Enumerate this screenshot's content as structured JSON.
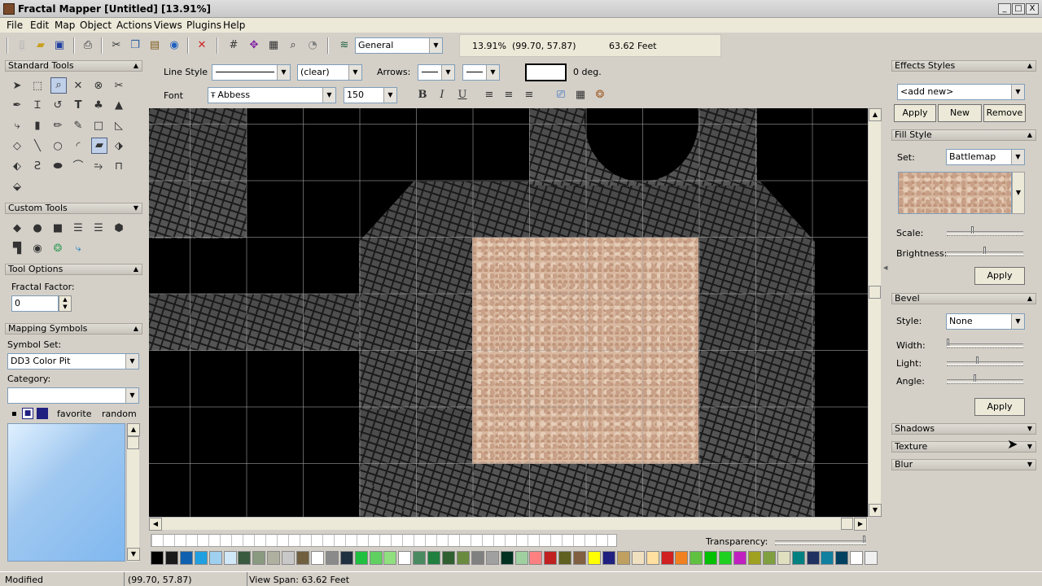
{
  "window": {
    "title": "Fractal Mapper [Untitled] [13.91%]",
    "min": "_",
    "max": "□",
    "close": "X"
  },
  "menu": [
    "File",
    "Edit",
    "Map",
    "Object",
    "Actions",
    "Views",
    "Plugins",
    "Help"
  ],
  "toolbar": {
    "layer": "General",
    "zoom": "13.91%",
    "coords": "(99.70, 57.87)",
    "span": "63.62 Feet"
  },
  "linestyle": {
    "label": "Line Style",
    "fill": "(clear)",
    "arrows_label": "Arrows:",
    "angle": "0 deg."
  },
  "font": {
    "label": "Font",
    "name": "Abbess",
    "size": "150",
    "bold": "B",
    "italic": "I",
    "underline": "U"
  },
  "left": {
    "standard_tools": "Standard Tools",
    "custom_tools": "Custom Tools",
    "tool_options": "Tool Options",
    "fractal_label": "Fractal Factor:",
    "fractal_value": "0",
    "mapping_symbols": "Mapping Symbols",
    "symbol_set_label": "Symbol Set:",
    "symbol_set": "DD3 Color Pit",
    "category_label": "Category:",
    "category": "",
    "favorite": "favorite",
    "random": "random"
  },
  "right": {
    "effects_title": "Effects Styles",
    "effects_combo": "<add new>",
    "apply": "Apply",
    "new": "New",
    "remove": "Remove",
    "fill_title": "Fill Style",
    "set_label": "Set:",
    "set_value": "Battlemap",
    "scale_label": "Scale:",
    "brightness_label": "Brightness:",
    "fill_apply": "Apply",
    "bevel_title": "Bevel",
    "style_label": "Style:",
    "style_value": "None",
    "width_label": "Width:",
    "light_label": "Light:",
    "angle_label": "Angle:",
    "bevel_apply": "Apply",
    "shadows": "Shadows",
    "texture": "Texture",
    "blur": "Blur"
  },
  "palette": {
    "transparency_label": "Transparency:",
    "colors": [
      "#000000",
      "#1a1a1a",
      "#1060b0",
      "#20a0e0",
      "#a0d0f0",
      "#d0e8f8",
      "#3a5a40",
      "#8a9a80",
      "#b0b0a0",
      "#c8c8c8",
      "#706040",
      "#ffffff",
      "#8a8a8a",
      "#203040",
      "#20c040",
      "#60d060",
      "#90e080",
      "#ffffff",
      "#4a8a60",
      "#208040",
      "#306030",
      "#6a8a40",
      "#808080",
      "#a0a0a0",
      "#003020",
      "#a0d0a0",
      "#ff8080",
      "#c02020",
      "#606020",
      "#806040",
      "#ffff00",
      "#202080",
      "#c0a060",
      "#f0e0c0",
      "#ffe0a0",
      "#d02020",
      "#f08020",
      "#60c040",
      "#00c000",
      "#20d020",
      "#c020c0",
      "#a0a020",
      "#80a040",
      "#e0e0c0",
      "#008080",
      "#203060",
      "#1080a0",
      "#004060",
      "#ffffff",
      "#f0f0f0"
    ]
  },
  "status": {
    "modified": "Modified",
    "coords": "(99.70, 57.87)",
    "span": "View Span: 63.62 Feet"
  }
}
